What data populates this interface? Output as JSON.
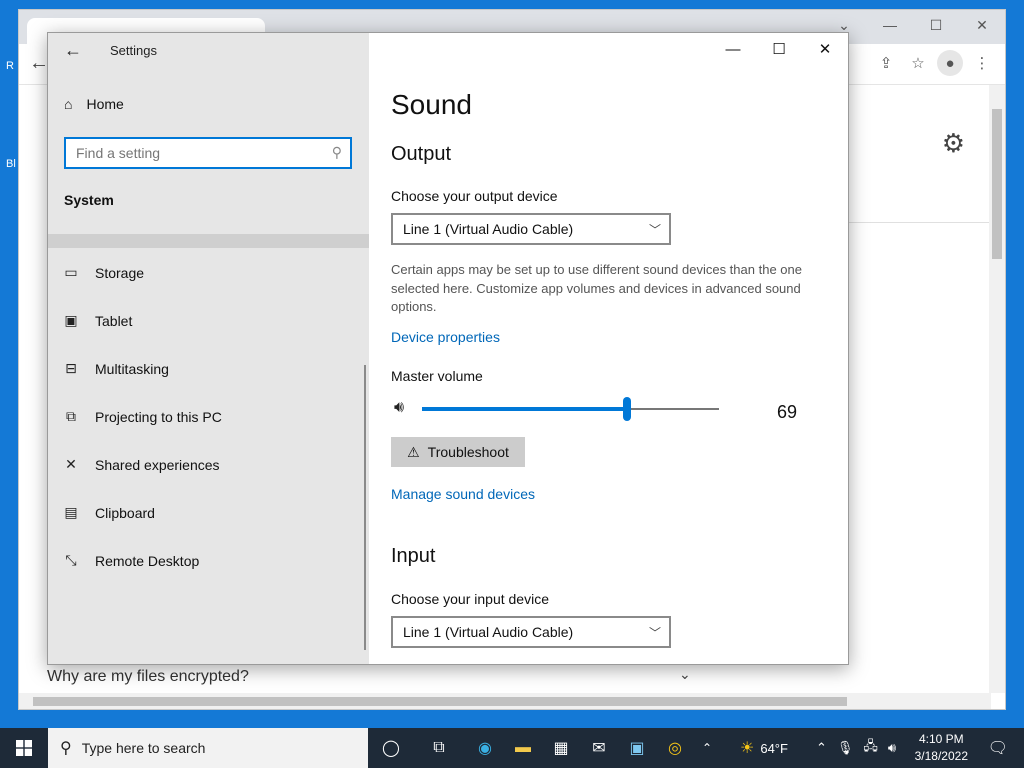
{
  "desktop": {
    "icon_labels": [
      "R",
      "Bl"
    ]
  },
  "chrome": {
    "faq_text": "Why are my files encrypted?"
  },
  "settings": {
    "window_title": "Settings",
    "home_label": "Home",
    "search_placeholder": "Find a setting",
    "section_label": "System",
    "nav_items": [
      {
        "label": "Storage",
        "icon": "storage-icon"
      },
      {
        "label": "Tablet",
        "icon": "tablet-icon"
      },
      {
        "label": "Multitasking",
        "icon": "multitasking-icon"
      },
      {
        "label": "Projecting to this PC",
        "icon": "projecting-icon"
      },
      {
        "label": "Shared experiences",
        "icon": "shared-experiences-icon"
      },
      {
        "label": "Clipboard",
        "icon": "clipboard-icon"
      },
      {
        "label": "Remote Desktop",
        "icon": "remote-desktop-icon"
      }
    ],
    "content": {
      "page_title": "Sound",
      "output_heading": "Output",
      "output_device_label": "Choose your output device",
      "output_device_value": "Line 1 (Virtual Audio Cable)",
      "output_description": "Certain apps may be set up to use different sound devices than the one selected here. Customize app volumes and devices in advanced sound options.",
      "device_properties_link": "Device properties",
      "master_volume_label": "Master volume",
      "master_volume_value": "69",
      "master_volume_fraction": 0.69,
      "troubleshoot_label": "Troubleshoot",
      "manage_devices_link": "Manage sound devices",
      "input_heading": "Input",
      "input_device_label": "Choose your input device",
      "input_device_value": "Line 1 (Virtual Audio Cable)"
    }
  },
  "taskbar": {
    "search_placeholder": "Type here to search",
    "weather": "64°F",
    "time": "4:10 PM",
    "date": "3/18/2022"
  },
  "colors": {
    "accent": "#0078d7",
    "link": "#0067b8",
    "taskbar": "#1e2a38",
    "desktop": "#1479d6"
  }
}
